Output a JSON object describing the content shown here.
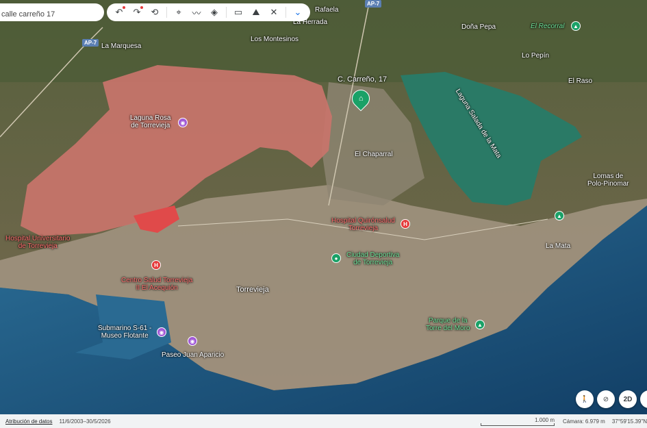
{
  "search": {
    "value": "calle carreño 17"
  },
  "toolbar": {
    "undo": "↶",
    "redo": "↷",
    "history": "⟲",
    "pin": "📍",
    "path": "〰",
    "layers": "◈",
    "ruler": "▭",
    "image": "⛰",
    "tools": "✕",
    "more": "⌄"
  },
  "labels": {
    "ap7_top": "AP-7",
    "ap7_left": "AP-7",
    "la_marquesa": "La Marquesa",
    "la_herrada": "La Herrada",
    "rafaela": "Rafaela",
    "los_montesinos": "Los Montesinos",
    "dona_pepa": "Doña Pepa",
    "el_recorral": "El Recorral",
    "lo_pepin": "Lo Pepín",
    "el_raso": "El Raso",
    "c_carreno": "C. Carreño, 17",
    "laguna_rosa": "Laguna Rosa\nde Torrevieja",
    "laguna_salada": "Laguna Salada de la Mata",
    "el_chaparral": "El Chaparral",
    "lomas": "Lomas de\nPolo-Pinomar",
    "hospital_univ": "Hospital Universitario\nde Torrevieja",
    "hospital_quiron": "Hospital Quirónsalud\nTorrevieja",
    "la_mata": "La Mata",
    "ciudad_deportiva": "Ciudad Deportiva\nde Torrevieja",
    "centro_salud": "Centro Salud Torrevieja\nII El Acequión",
    "torrevieja": "Torrevieja",
    "submarino": "Submarino S-61 -\nMuseo Flotante",
    "paseo": "Paseo Juan Aparicio",
    "parque": "Parque de la\nTorre del Moro"
  },
  "buttons": {
    "street_view": "🚶",
    "compass": "⊘",
    "mode_2d": "2D",
    "tilt": "⌃"
  },
  "status": {
    "attribution": "Atribución de datos",
    "dates": "11/6/2003–30/5/2026",
    "scale": "1.000 m",
    "camera": "Cámara: 6.979 m",
    "coords": "37°59'15.39\"N"
  },
  "colors": {
    "lagoon_pink": "#c9746b",
    "lagoon_green": "#2a7a66",
    "sea": "#1d5f8a"
  }
}
